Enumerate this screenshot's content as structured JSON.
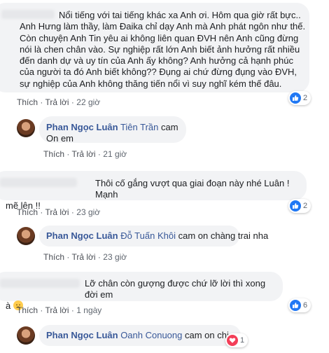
{
  "comments": [
    {
      "lines": [
        "Nổi tiếng với tai tiếng khác xa Anh ơi. Hôm qua giờ rất bực..",
        "Anh Hưng làm thầy, làm Đaika chỉ dạy Anh mà Anh phát ngôn như thế.",
        "Còn chuyện Anh Tin yêu ai không liên quan ĐVH nên Anh cũng đừng",
        "nói là chen chân vào. Sự nghiệp rất lớn Anh biết ảnh hưởng rất nhiều",
        "đến danh dự và uy tín của Anh ấy không? Anh hưởng cả hạnh phúc",
        "của người ta đó Anh biết không?? Đụng ai chứ đừng đụng vào ĐVH,",
        "sự nghiệp của Anh không thăng tiến nổi vì suy nghĩ kém thế đâu."
      ],
      "reaction_count": "2",
      "actions": {
        "like": "Thích",
        "reply": "Trả lời",
        "time": "22 giờ"
      }
    },
    {
      "author": "Phan Ngọc Luân",
      "tag": "Tiên Trần",
      "line1_rest": "cam",
      "line2": "On em",
      "actions": {
        "like": "Thích",
        "reply": "Trả lời",
        "time": "21 giờ"
      }
    },
    {
      "line1": "Thôi cố gắng vượt qua giai đoạn này nhé Luân ! Mạnh",
      "line2": "mẽ lên !!",
      "reaction_count": "2",
      "actions": {
        "like": "Thích",
        "reply": "Trả lời",
        "time": "23 giờ"
      }
    },
    {
      "author": "Phan Ngọc Luân",
      "tag": "Đỗ Tuấn Khôi",
      "text": "cam on chàng trai nha",
      "actions": {
        "like": "Thích",
        "reply": "Trả lời",
        "time": "23 giờ"
      }
    },
    {
      "line1": "Lỡ chân còn gượng được chứ lỡ lời thì xong đời em",
      "line2": "à",
      "reaction_count": "6",
      "actions": {
        "like": "Thích",
        "reply": "Trả lời",
        "time": "1 ngày"
      }
    },
    {
      "author": "Phan Ngọc Luân",
      "tag": "Oanh Conuong",
      "text": "cam on chi",
      "reaction_count": "1"
    }
  ],
  "colors": {
    "link": "#385898",
    "like": "#2078f4",
    "heart": "#f33e58",
    "bubble": "#f2f3f5"
  }
}
